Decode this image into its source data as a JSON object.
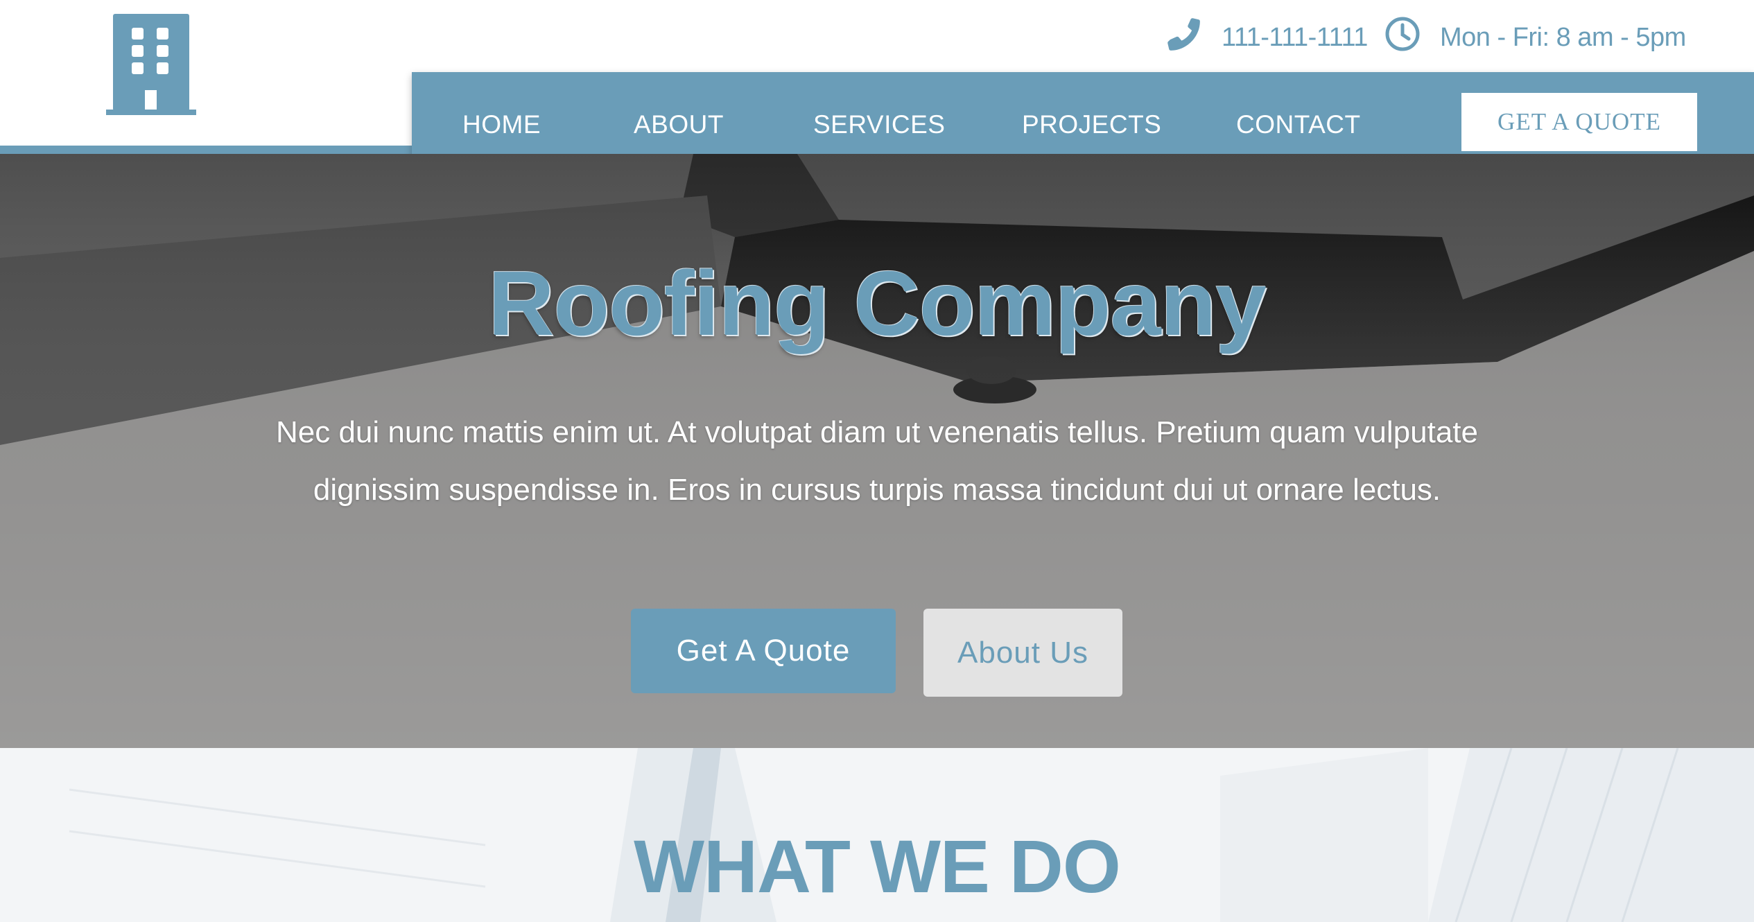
{
  "brand": {
    "logo_icon": "building-icon",
    "accent_color": "#6a9db8"
  },
  "topbar": {
    "phone": {
      "icon": "phone-icon",
      "text": "111-111-1111"
    },
    "hours": {
      "icon": "clock-icon",
      "text": "Mon - Fri: 8 am - 5pm"
    }
  },
  "nav": {
    "items": [
      {
        "label": "HOME"
      },
      {
        "label": "ABOUT"
      },
      {
        "label": "SERVICES"
      },
      {
        "label": "PROJECTS"
      },
      {
        "label": "CONTACT"
      }
    ],
    "quote_button": "GET A QUOTE"
  },
  "hero": {
    "title": "Roofing Company",
    "text": "Nec dui nunc mattis enim ut. At volutpat diam ut venenatis tellus. Pretium quam vulputate dignissim suspendisse in. Eros in cursus turpis massa tincidunt dui ut ornare lectus.",
    "primary_button": "Get A Quote",
    "secondary_button": "About Us"
  },
  "section": {
    "title": "WHAT WE DO"
  }
}
